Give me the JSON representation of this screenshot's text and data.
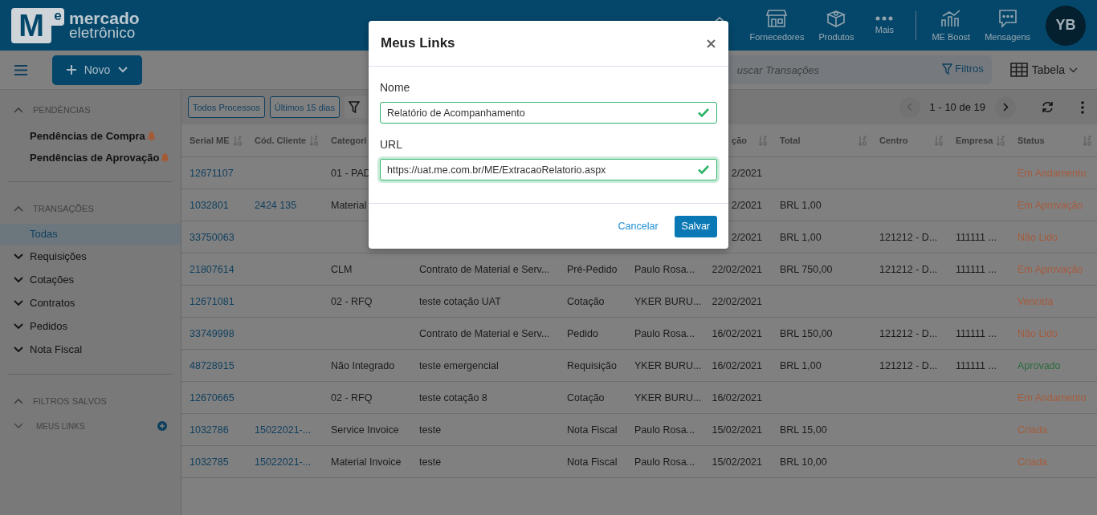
{
  "header": {
    "logo": {
      "mark": "M",
      "mark_sup": "e",
      "name": "mercado",
      "tagline": "eletrônico"
    },
    "nav": [
      {
        "kind": "home"
      },
      {
        "kind": "store",
        "label": "Fornecedores"
      },
      {
        "kind": "box",
        "label": "Produtos"
      },
      {
        "kind": "more",
        "label": "Mais"
      },
      {
        "kind": "chart",
        "label": "ME Boost"
      },
      {
        "kind": "chat",
        "label": "Mensagens"
      }
    ],
    "avatar": "YB"
  },
  "toolbar": {
    "new_button": "Novo",
    "search": {
      "placeholder": "uscar Transações"
    },
    "filters_button": "Filtros",
    "view_select": "Tabela"
  },
  "sidebar": {
    "sections": [
      {
        "title": "PENDÊNCIAS",
        "expanded": true,
        "items": [
          {
            "label": "Pendências de Compra",
            "kind": "alert"
          },
          {
            "label": "Pendências de Aprovação",
            "kind": "alert"
          }
        ]
      },
      {
        "title": "TRANSAÇÕES",
        "expanded": true,
        "items": [
          {
            "label": "Todas",
            "kind": "link",
            "selected": true
          },
          {
            "label": "Requisições",
            "kind": "group",
            "expanded": false,
            "selected": false
          },
          {
            "label": "Cotações",
            "kind": "group",
            "expanded": false,
            "selected": false
          },
          {
            "label": "Contratos",
            "kind": "group",
            "expanded": false,
            "selected": false
          },
          {
            "label": "Pedidos",
            "kind": "group",
            "expanded": false,
            "selected": false
          },
          {
            "label": "Nota Fiscal",
            "kind": "group",
            "expanded": false,
            "selected": false
          }
        ]
      },
      {
        "title": "FILTROS SALVOS",
        "expanded": true,
        "items": [
          {
            "label": "MEUS LINKS",
            "kind": "subsection",
            "expanded": false
          }
        ]
      }
    ]
  },
  "filter_bar": {
    "chips": [
      "Todos Processos",
      "Últimos 15 dias"
    ],
    "pagination": "1 - 10 de 19"
  },
  "table": {
    "columns": [
      {
        "label": "Serial ME",
        "kind": "sortable"
      },
      {
        "label": "Cód. Cliente",
        "kind": "sortable"
      },
      {
        "label": "Categori",
        "kind": "plain"
      },
      null,
      null,
      null,
      {
        "label": "ção",
        "kind": "sortable"
      },
      {
        "label": "Total",
        "kind": "sortable"
      },
      {
        "label": "Centro",
        "kind": "sortable"
      },
      {
        "label": "Empresa",
        "kind": "sortable"
      },
      {
        "label": "Status",
        "kind": "sortable"
      }
    ],
    "rows": [
      {
        "cells": [
          "12671107",
          null,
          "01 - PAD",
          null,
          null,
          null,
          "2/2021",
          null,
          null,
          null,
          "Em Andamento"
        ],
        "color": "#a65b3d"
      },
      {
        "cells": [
          "1032801",
          "2424 135",
          "Material",
          null,
          null,
          null,
          "2/2021",
          "BRL 1,00",
          null,
          null,
          "Em Aprovação"
        ],
        "color": "#a65b3d"
      },
      {
        "cells": [
          "33750063",
          null,
          null,
          null,
          null,
          null,
          "2/2021",
          "BRL 1,00",
          "121212 - D...",
          "111111 ...",
          "Não Lido"
        ],
        "color": "#a65b3d"
      },
      {
        "cells": [
          "21807614",
          null,
          "CLM",
          "Contrato de Material e Serv...",
          "Pré-Pedido",
          "Paulo Rosa...",
          "22/02/2021",
          "BRL 750,00",
          "121212 - D...",
          "111111 ...",
          "Em Aprovação"
        ],
        "color": "#a65b3d"
      },
      {
        "cells": [
          "12671081",
          null,
          "02 - RFQ",
          "teste cotação UAT",
          "Cotação",
          "YKER BURU...",
          "22/02/2021",
          null,
          null,
          null,
          "Vencida"
        ],
        "color": "#a65b3d"
      },
      {
        "cells": [
          "33749998",
          null,
          null,
          "Contrato de Material e Serv...",
          "Pedido",
          "Paulo Rosa...",
          "16/02/2021",
          "BRL 150,00",
          "121212 - D...",
          "111111 ...",
          "Não Lido"
        ],
        "color": "#a65b3d"
      },
      {
        "cells": [
          "48728915",
          null,
          "Não Integrado",
          "teste emergencial",
          "Requisição",
          "YKER BURU...",
          "16/02/2021",
          "BRL 1,00",
          "121212 - D...",
          "111111 ...",
          "Aprovado"
        ],
        "color": "#2c6b3f"
      },
      {
        "cells": [
          "12670665",
          null,
          "02 - RFQ",
          "teste cotação 8",
          "Cotação",
          "YKER BURU...",
          "16/02/2021",
          null,
          null,
          null,
          "Em Andamento"
        ],
        "color": "#a65b3d"
      },
      {
        "cells": [
          "1032786",
          "15022021-...",
          "Service Invoice",
          "teste",
          "Nota Fiscal",
          "Paulo Rosa...",
          "15/02/2021",
          "BRL 15,00",
          null,
          null,
          "Criada"
        ],
        "color": "#a65b3d"
      },
      {
        "cells": [
          "1032785",
          "15022021-...",
          "Material Invoice",
          "teste",
          "Nota Fiscal",
          "Paulo Rosa...",
          "15/02/2021",
          "BRL 10,00",
          null,
          null,
          "Criada"
        ],
        "color": "#a65b3d"
      }
    ]
  },
  "modal": {
    "title": "Meus Links",
    "fields": [
      {
        "label": "Nome",
        "value": "Relatório de Acompanhamento",
        "valid": true,
        "focused": false
      },
      {
        "label": "URL",
        "value": "https://uat.me.com.br/ME/ExtracaoRelatorio.aspx",
        "valid": true,
        "focused": true
      }
    ],
    "cancel": "Cancelar",
    "save": "Salvar"
  }
}
